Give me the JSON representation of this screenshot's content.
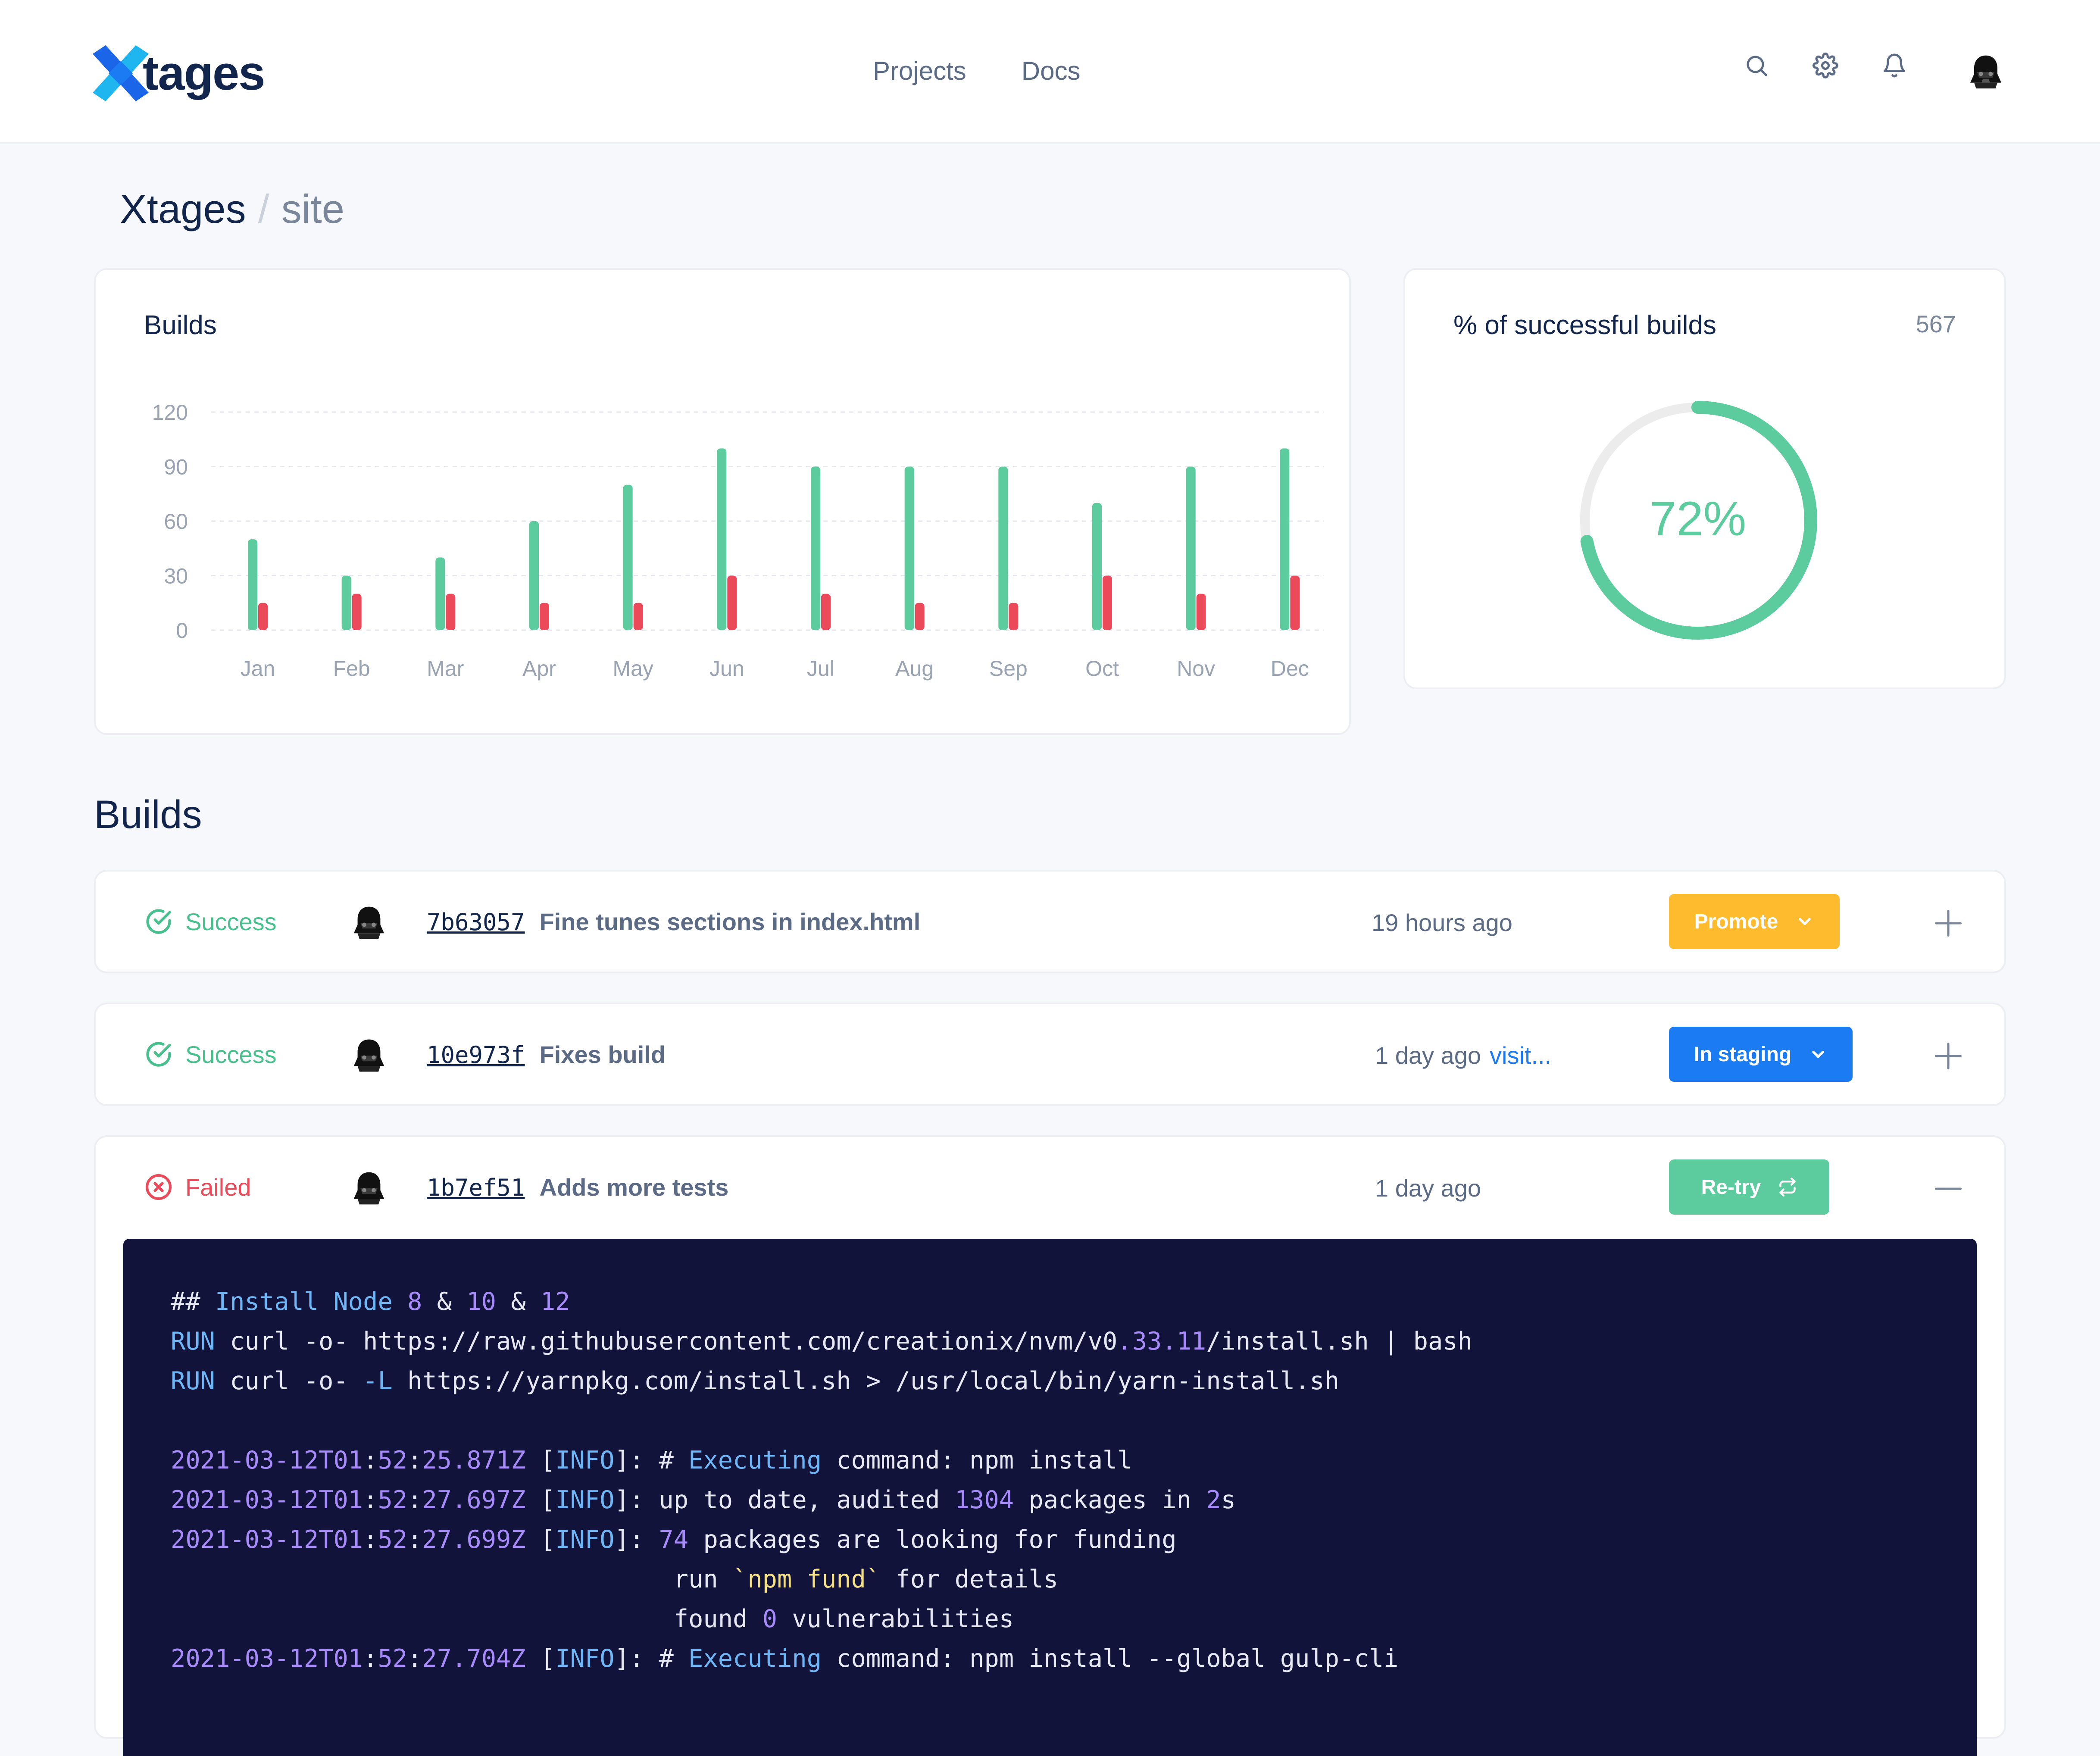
{
  "header": {
    "brand": "tages",
    "nav": [
      "Projects",
      "Docs"
    ],
    "icons": [
      "search-icon",
      "gear-icon",
      "bell-icon",
      "avatar"
    ]
  },
  "breadcrumb": {
    "org": "Xtages",
    "separator": "/",
    "project": "site"
  },
  "builds_card": {
    "title": "Builds"
  },
  "success_card": {
    "title": "% of successful builds",
    "count": "567",
    "percent_label": "72%",
    "percent": 72
  },
  "chart_data": {
    "type": "bar",
    "categories": [
      "Jan",
      "Feb",
      "Mar",
      "Apr",
      "May",
      "Jun",
      "Jul",
      "Aug",
      "Sep",
      "Oct",
      "Nov",
      "Dec"
    ],
    "series": [
      {
        "color": "#5ccb9e",
        "values": [
          50,
          30,
          40,
          60,
          80,
          100,
          90,
          90,
          90,
          70,
          90,
          100
        ]
      },
      {
        "color": "#ea4a5a",
        "values": [
          15,
          20,
          20,
          15,
          15,
          30,
          20,
          15,
          15,
          30,
          20,
          30
        ]
      }
    ],
    "yticks": [
      0,
      30,
      60,
      90,
      120
    ],
    "ylim": [
      0,
      120
    ],
    "grid": true
  },
  "builds_section": {
    "title": "Builds"
  },
  "builds": [
    {
      "status": "Success",
      "hash": "7b63057",
      "message": "Fine tunes sections in index.html",
      "time": "19 hours ago",
      "link": "",
      "action": "Promote",
      "toggle": "+"
    },
    {
      "status": "Success",
      "hash": "10e973f",
      "message": "Fixes build",
      "time": "1 day ago",
      "link": "visit...",
      "action": "In staging",
      "toggle": "+"
    },
    {
      "status": "Failed",
      "hash": "1b7ef51",
      "message": "Adds more tests",
      "time": "1 day ago",
      "link": "",
      "action": "Re-try",
      "toggle": "—"
    }
  ],
  "colors": {
    "success": "#48c08e",
    "failed": "#ea4a5a",
    "promote": "#fdbb2d",
    "staging": "#1b7bf2",
    "retry": "#5ccb9e",
    "log_bg": "#12133a"
  },
  "log": [
    [
      [
        "## ",
        ""
      ],
      [
        "Install Node ",
        "kw"
      ],
      [
        "8",
        "num"
      ],
      [
        " & ",
        ""
      ],
      [
        "10",
        "num"
      ],
      [
        " & ",
        ""
      ],
      [
        "12",
        "num"
      ]
    ],
    [
      [
        "RUN",
        "kw"
      ],
      [
        " curl -o- https://raw.githubusercontent.com/creationix/nvm/v0",
        ""
      ],
      [
        ".33.11",
        "num"
      ],
      [
        "/install.sh | bash",
        ""
      ]
    ],
    [
      [
        "RUN",
        "kw"
      ],
      [
        " curl -o- ",
        ""
      ],
      [
        "-L",
        "kw"
      ],
      [
        " https://yarnpkg.com/install.sh > /usr/local/bin/yarn-install.sh",
        ""
      ]
    ],
    [],
    [
      [
        "2021-03-12T01",
        "num"
      ],
      [
        ":",
        ""
      ],
      [
        "52",
        "num"
      ],
      [
        ":",
        ""
      ],
      [
        "25.871Z",
        "num"
      ],
      [
        " [",
        ""
      ],
      [
        "INFO",
        "kw"
      ],
      [
        "]: # ",
        ""
      ],
      [
        "Executing",
        "kw"
      ],
      [
        " command: npm install",
        ""
      ]
    ],
    [
      [
        "2021-03-12T01",
        "num"
      ],
      [
        ":",
        ""
      ],
      [
        "52",
        "num"
      ],
      [
        ":",
        ""
      ],
      [
        "27.697Z",
        "num"
      ],
      [
        " [",
        ""
      ],
      [
        "INFO",
        "kw"
      ],
      [
        "]: up to date, audited ",
        ""
      ],
      [
        "1304",
        "num"
      ],
      [
        " packages in ",
        ""
      ],
      [
        "2",
        "num"
      ],
      [
        "s",
        ""
      ]
    ],
    [
      [
        "2021-03-12T01",
        "num"
      ],
      [
        ":",
        ""
      ],
      [
        "52",
        "num"
      ],
      [
        ":",
        ""
      ],
      [
        "27.699Z",
        "num"
      ],
      [
        " [",
        ""
      ],
      [
        "INFO",
        "kw"
      ],
      [
        "]: ",
        ""
      ],
      [
        "74",
        "num"
      ],
      [
        " packages are looking for funding",
        ""
      ]
    ],
    [
      [
        "                                  run ",
        ""
      ],
      [
        "`npm fund`",
        "str"
      ],
      [
        " for details",
        ""
      ]
    ],
    [
      [
        "                                  found ",
        ""
      ],
      [
        "0",
        "num"
      ],
      [
        " vulnerabilities",
        ""
      ]
    ],
    [
      [
        "2021-03-12T01",
        "num"
      ],
      [
        ":",
        ""
      ],
      [
        "52",
        "num"
      ],
      [
        ":",
        ""
      ],
      [
        "27.704Z",
        "num"
      ],
      [
        " [",
        ""
      ],
      [
        "INFO",
        "kw"
      ],
      [
        "]: # ",
        ""
      ],
      [
        "Executing",
        "kw"
      ],
      [
        " command: npm install --global gulp-cli",
        ""
      ]
    ]
  ]
}
